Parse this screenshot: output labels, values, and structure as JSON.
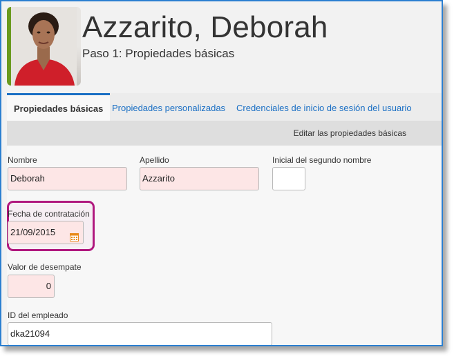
{
  "header": {
    "name": "Azzarito, Deborah",
    "step": "Paso 1: Propiedades básicas"
  },
  "tabs": [
    {
      "label": "Propiedades básicas",
      "active": true
    },
    {
      "label": "Propiedades personalizadas",
      "active": false
    },
    {
      "label": "Credenciales de inicio de sesión del usuario",
      "active": false
    }
  ],
  "subheader": {
    "label": "Editar las propiedades básicas"
  },
  "form": {
    "first_name": {
      "label": "Nombre",
      "value": "Deborah"
    },
    "last_name": {
      "label": "Apellido",
      "value": "Azzarito"
    },
    "middle_initial": {
      "label": "Inicial del segundo nombre",
      "value": ""
    },
    "hire_date": {
      "label": "Fecha de contratación",
      "value": "21/09/2015"
    },
    "tiebreak": {
      "label": "Valor de desempate",
      "value": "0"
    },
    "employee_id": {
      "label": "ID del empleado",
      "value": "dka21094"
    }
  },
  "colors": {
    "frame_border": "#2b7fd1",
    "accent_link": "#1a6fc4",
    "photo_stripe": "#6a9a1f",
    "highlight": "#b0177e",
    "required_field_bg": "#fde6e6",
    "calendar_icon": "#e88a1a"
  },
  "icons": {
    "hire_date": "calendar-icon"
  }
}
